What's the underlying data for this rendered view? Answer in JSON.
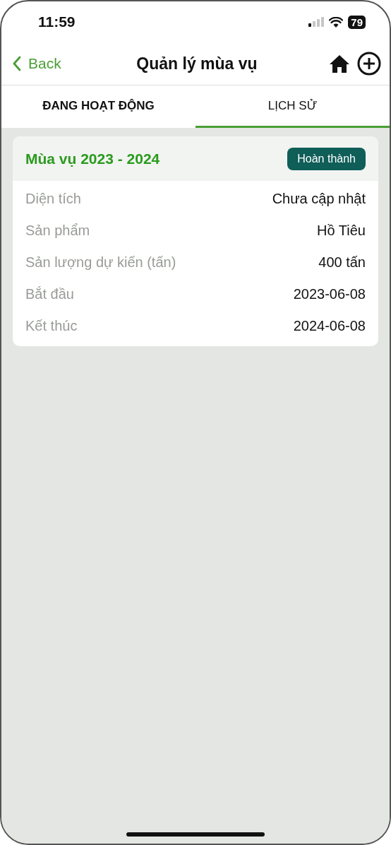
{
  "status_bar": {
    "time": "11:59",
    "battery": "79"
  },
  "nav": {
    "back": "Back",
    "title": "Quản lý mùa vụ"
  },
  "tabs": [
    {
      "label": "ĐANG HOẠT ĐỘNG",
      "selected": false
    },
    {
      "label": "LỊCH SỬ",
      "selected": true
    }
  ],
  "seasons": [
    {
      "title": "Mùa vụ 2023 - 2024",
      "status": "Hoàn thành",
      "fields": [
        {
          "label": "Diện tích",
          "value": "Chưa cập nhật"
        },
        {
          "label": "Sản phẩm",
          "value": "Hồ Tiêu"
        },
        {
          "label": "Sản lượng dự kiến (tấn)",
          "value": "400 tấn"
        },
        {
          "label": "Bắt đầu",
          "value": "2023-06-08"
        },
        {
          "label": "Kết thúc",
          "value": "2024-06-08"
        }
      ]
    }
  ]
}
